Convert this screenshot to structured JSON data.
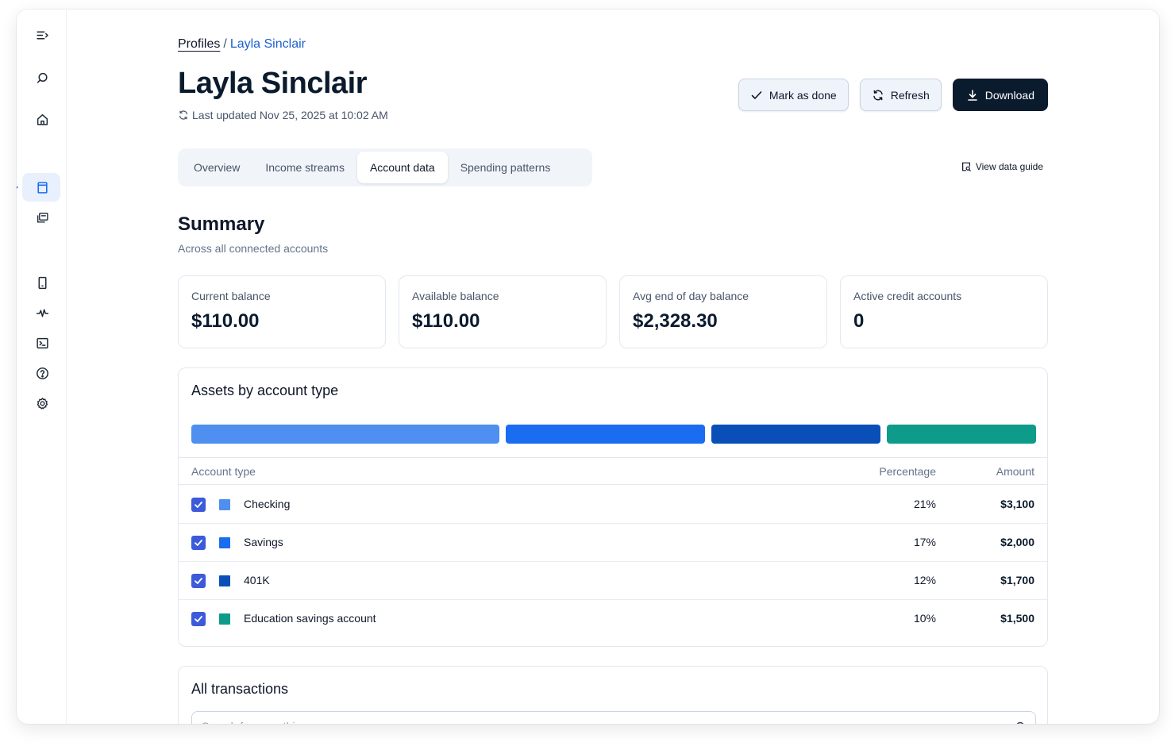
{
  "sidebar": {
    "items": [
      {
        "name": "collapse-menu-icon"
      },
      {
        "name": "search-icon"
      },
      {
        "name": "home-icon"
      },
      {
        "name": "profiles-icon",
        "active": true
      },
      {
        "name": "gallery-icon"
      },
      {
        "name": "mobile-icon"
      },
      {
        "name": "activity-icon"
      },
      {
        "name": "terminal-icon"
      },
      {
        "name": "help-icon"
      },
      {
        "name": "settings-icon"
      }
    ],
    "accent": "#1a6cf0"
  },
  "breadcrumb": {
    "root": "Profiles",
    "separator": "/",
    "current": "Layla Sinclair"
  },
  "header": {
    "title": "Layla Sinclair",
    "updated": "Last updated Nov 25, 2025 at 10:02 AM"
  },
  "actions": {
    "mark_done": "Mark as done",
    "refresh": "Refresh",
    "download": "Download"
  },
  "tabs": [
    {
      "label": "Overview"
    },
    {
      "label": "Income streams"
    },
    {
      "label": "Account data",
      "active": true
    },
    {
      "label": "Spending patterns"
    }
  ],
  "guide_link": "View data guide",
  "summary": {
    "title": "Summary",
    "subtitle": "Across all connected accounts",
    "cards": [
      {
        "label": "Current balance",
        "value": "$110.00"
      },
      {
        "label": "Available balance",
        "value": "$110.00"
      },
      {
        "label": "Avg end of day balance",
        "value": "$2,328.30"
      },
      {
        "label": "Active credit accounts",
        "value": "0"
      }
    ]
  },
  "assets": {
    "title": "Assets by account type",
    "columns": {
      "type": "Account type",
      "percentage": "Percentage",
      "amount": "Amount"
    },
    "rows": [
      {
        "type": "Checking",
        "percentage": "21%",
        "amount": "$3,100",
        "color": "#4f8ff0",
        "checked": true
      },
      {
        "type": "Savings",
        "percentage": "17%",
        "amount": "$2,000",
        "color": "#1a6cf0",
        "checked": true
      },
      {
        "type": "401K",
        "percentage": "12%",
        "amount": "$1,700",
        "color": "#0a4fb8",
        "checked": true
      },
      {
        "type": "Education savings account",
        "percentage": "10%",
        "amount": "$1,500",
        "color": "#0d9b8a",
        "checked": true
      }
    ]
  },
  "transactions": {
    "title": "All transactions",
    "search_placeholder": "Search for something"
  }
}
